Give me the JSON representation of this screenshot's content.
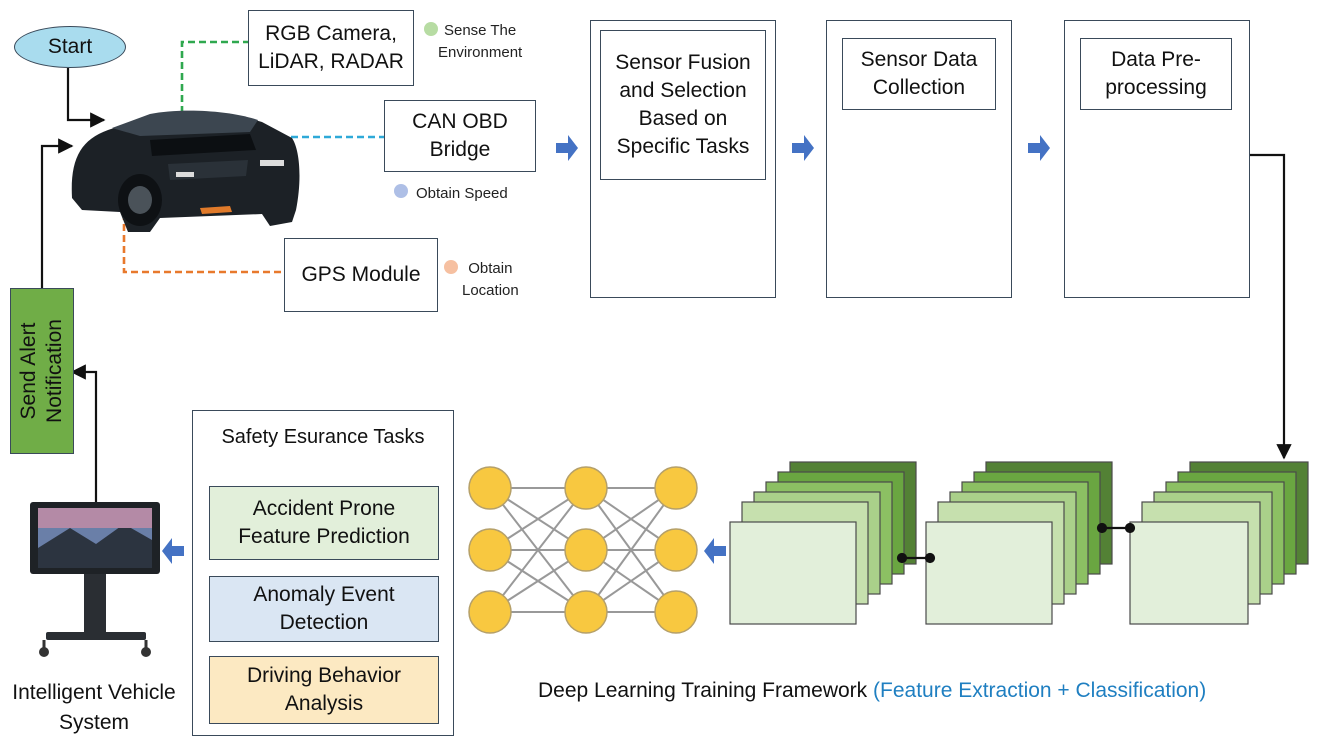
{
  "start": {
    "label": "Start"
  },
  "inputs": {
    "rgb": {
      "label": "RGB Camera,\nLiDAR, RADAR"
    },
    "can": {
      "label": "CAN OBD\nBridge"
    },
    "gps": {
      "label": "GPS Module"
    }
  },
  "legend": {
    "sense": {
      "label": "Sense The\nEnvironment",
      "color": "#b7dca3"
    },
    "speed": {
      "label": "Obtain Speed",
      "color": "#aebfe6"
    },
    "location": {
      "label": "Obtain\nLocation",
      "color": "#f6c0a1"
    }
  },
  "pipeline": {
    "fusion": {
      "label": "Sensor Fusion\nand Selection\nBased on\nSpecific Tasks"
    },
    "collection": {
      "label": "Sensor Data\nCollection"
    },
    "preprocessing": {
      "label": "Data Pre-\nprocessing"
    }
  },
  "alert": {
    "label": "Send Alert\nNotification",
    "color": "#70ad47"
  },
  "safety": {
    "title": "Safety Esurance Tasks",
    "tasks": [
      {
        "label": "Accident Prone\nFeature Prediction",
        "color": "#e2efda"
      },
      {
        "label": "Anomaly Event\nDetection",
        "color": "#dae6f3"
      },
      {
        "label": "Driving Behavior\nAnalysis",
        "color": "#fce9c2"
      }
    ]
  },
  "system": {
    "label": "Intelligent Vehicle\nSystem"
  },
  "framework": {
    "caption": "Deep Learning Training Framework",
    "caption_highlight": "(Feature Extraction + Classification)",
    "highlight_color": "#1f7fc1"
  },
  "colors": {
    "arrow_blue": "#4472c4",
    "green_line": "#2fa84f",
    "cyan_line": "#2ea9d8",
    "orange_line": "#e8792c",
    "node_yellow": "#f8c840",
    "db_blue": "#2b7fe0",
    "start_fill": "#a9dcee"
  }
}
